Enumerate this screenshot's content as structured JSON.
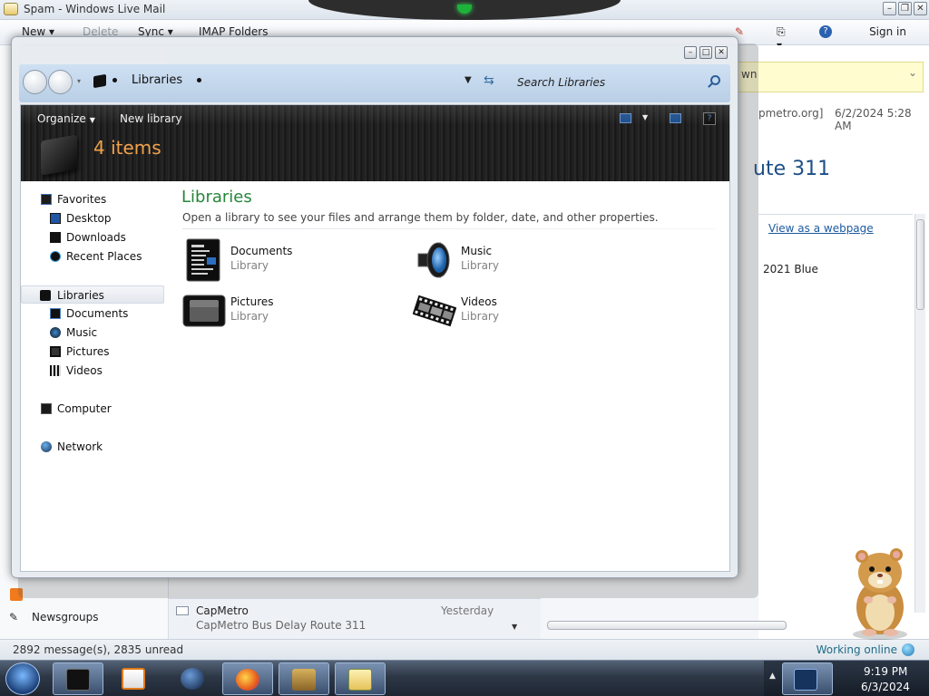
{
  "mail": {
    "title": "Spam - Windows Live Mail",
    "toolbar": {
      "new": "New",
      "delete": "Delete",
      "sync": "Sync",
      "imap": "IMAP Folders",
      "sign_in": "Sign in"
    },
    "info_bar_text": "wn",
    "reading": {
      "from": "pmetro.org]",
      "date": "6/2/2024 5:28 AM",
      "subject": "ute 311",
      "view_as_webpage": "View as a webpage",
      "body_snippet": "2021 Blue"
    },
    "newsgroups": "Newsgroups",
    "message": {
      "from": "CapMetro",
      "date": "Yesterday",
      "subject": "CapMetro Bus Delay Route 311"
    },
    "status": {
      "count": "2892 message(s), 2835 unread",
      "online": "Working online"
    }
  },
  "explorer": {
    "breadcrumb": "Libraries",
    "search_placeholder": "Search Libraries",
    "commands": {
      "organize": "Organize",
      "new_library": "New library"
    },
    "item_count": "4 items",
    "nav": {
      "favorites": "Favorites",
      "desktop": "Desktop",
      "downloads": "Downloads",
      "recent_places": "Recent Places",
      "libraries": "Libraries",
      "documents": "Documents",
      "music": "Music",
      "pictures": "Pictures",
      "videos": "Videos",
      "computer": "Computer",
      "network": "Network"
    },
    "content": {
      "title": "Libraries",
      "description": "Open a library to see your files and arrange them by folder, date, and other properties.",
      "items": [
        {
          "name": "Documents",
          "type": "Library"
        },
        {
          "name": "Music",
          "type": "Library"
        },
        {
          "name": "Pictures",
          "type": "Library"
        },
        {
          "name": "Videos",
          "type": "Library"
        }
      ]
    }
  },
  "taskbar": {
    "time": "9:19 PM",
    "date": "6/3/2024"
  },
  "colors": {
    "libraries_title": "#26863a",
    "item_count": "#f1a24a",
    "link": "#1d5aa0"
  }
}
